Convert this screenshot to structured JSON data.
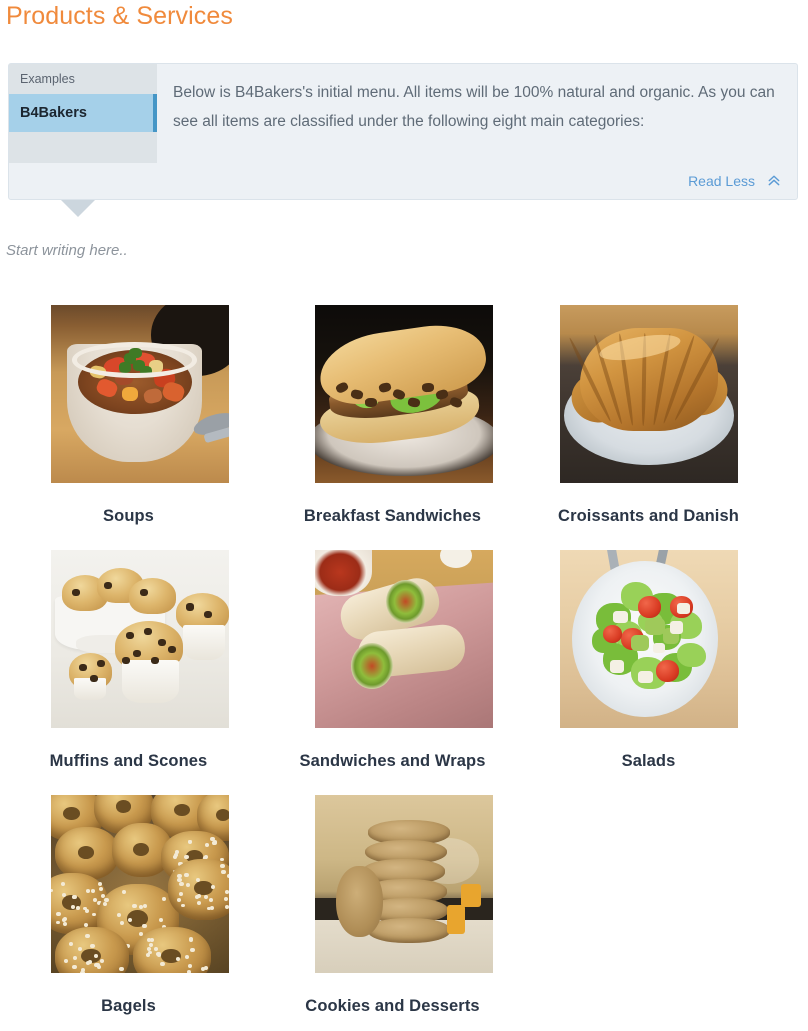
{
  "page": {
    "title": "Products & Services",
    "title_color": "#f08a3c"
  },
  "info_panel": {
    "sidebar": {
      "heading": "Examples",
      "items": [
        {
          "label": "B4Bakers",
          "selected": true
        }
      ]
    },
    "body_text": "Below is B4Bakers's initial menu. All items will be 100% natural and organic. As you can see all items are classified under the following eight main categories:",
    "toggle": {
      "label": "Read Less",
      "icon": "chevron-double-up-icon",
      "color": "#5b9bd5"
    },
    "background_color": "#edf1f5"
  },
  "editor": {
    "placeholder": "Start writing here.."
  },
  "product_grid": {
    "items": [
      {
        "label": "Soups",
        "art": "soup"
      },
      {
        "label": "Breakfast Sandwiches",
        "art": "bsand"
      },
      {
        "label": "Croissants and Danish",
        "art": "crois"
      },
      {
        "label": "Muffins and Scones",
        "art": "muf"
      },
      {
        "label": "Sandwiches and Wraps",
        "art": "wrap"
      },
      {
        "label": "Salads",
        "art": "salad"
      },
      {
        "label": "Bagels",
        "art": "bagel"
      },
      {
        "label": "Cookies and Desserts",
        "art": "cook"
      }
    ]
  }
}
